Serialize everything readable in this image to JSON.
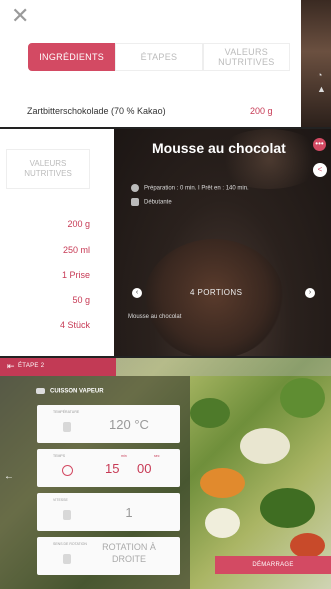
{
  "panel1": {
    "close_icon": "close-icon",
    "tabs": [
      "INGRÉDIENTS",
      "ÉTAPES",
      "VALEURS NUTRITIVES"
    ],
    "ingredient": {
      "name": "Zartbitterschokolade (70 % Kakao)",
      "qty": "200 g"
    }
  },
  "panel2": {
    "tab_values": "VALEURS NUTRITIVES",
    "quantities": [
      "200 g",
      "250 ml",
      "1 Prise",
      "50 g",
      "4 Stück"
    ],
    "title": "Mousse au chocolat",
    "meta_time": "Préparation : 0 min.  I  Prêt en : 140 min.",
    "meta_level": "Débutante",
    "portions": "4 PORTIONS",
    "caption": "Mousse au chocolat",
    "more_icon": "more-dots-icon",
    "share_icon": "share-icon"
  },
  "panel3": {
    "step": "ÉTAPE 2",
    "mode": "CUISSON VAPEUR",
    "temperature": {
      "label": "TEMPÉRATURE",
      "value": "120 °C"
    },
    "time": {
      "label": "TEMPS",
      "min_label": "min",
      "sec_label": "sec",
      "min": "15",
      "sec": "00"
    },
    "speed": {
      "label": "VITESSE",
      "value": "1"
    },
    "rotation": {
      "label": "SENS DE ROTATION",
      "value": "ROTATION À DROITE"
    },
    "start_button": "DÉMARRAGE"
  },
  "colors": {
    "accent": "#d34a63"
  }
}
